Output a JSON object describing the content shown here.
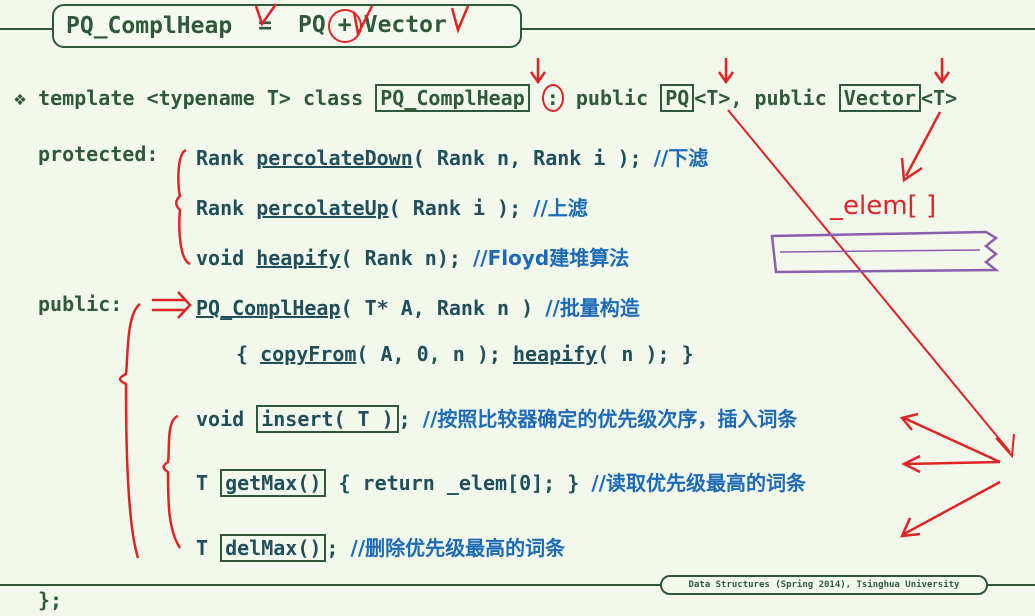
{
  "title": {
    "left": "PQ_ComplHeap",
    "eq": "=",
    "pq": "PQ",
    "plus": "+",
    "vector": "Vector"
  },
  "decl": {
    "bullet": "❖",
    "template": "template <typename T> class",
    "class_name": "PQ_ComplHeap",
    "colon": ":",
    "public1": "public",
    "pq": "PQ",
    "t1": "<T>,",
    "public2": "public",
    "vector": "Vector",
    "t2": "<T>"
  },
  "protected": {
    "label": "protected:",
    "lines": [
      {
        "type": "Rank",
        "fn": "percolateDown",
        "args": "( Rank n, Rank i );",
        "comment": "//下滤"
      },
      {
        "type": "Rank",
        "fn": "percolateUp",
        "args": "( Rank i );",
        "comment": "//上滤"
      },
      {
        "type": "void",
        "fn": "heapify",
        "args": "( Rank n);",
        "comment": "//Floyd建堆算法"
      }
    ]
  },
  "public": {
    "label": "public:",
    "ctor": {
      "fn": "PQ_ComplHeap",
      "args": "( T* A, Rank n )",
      "comment": "//批量构造"
    },
    "body": {
      "open": "{",
      "fn1": "copyFrom",
      "args1": "( A, 0, n );",
      "fn2": "heapify",
      "args2": "( n );",
      "close": "}"
    },
    "insert": {
      "type": "void",
      "sig": "insert( T )",
      "semi": ";",
      "comment": "//按照比较器确定的优先级次序，插入词条"
    },
    "getmax": {
      "type": "T",
      "sig": "getMax()",
      "body": "{ return _elem[0]; }",
      "comment": "//读取优先级最高的词条"
    },
    "delmax": {
      "type": "T",
      "sig": "delMax()",
      "semi": ";",
      "comment": "//删除优先级最高的词条"
    }
  },
  "closing": "};",
  "annotation": {
    "elem": "_elem[ ]"
  },
  "footer": "Data Structures (Spring 2014), Tsinghua University",
  "colors": {
    "background": "#f3f8ec",
    "code": "#2e5a39",
    "comment": "#1d6bb8",
    "annotation_red": "#e02424",
    "annotation_purple": "#8a5fb0"
  }
}
